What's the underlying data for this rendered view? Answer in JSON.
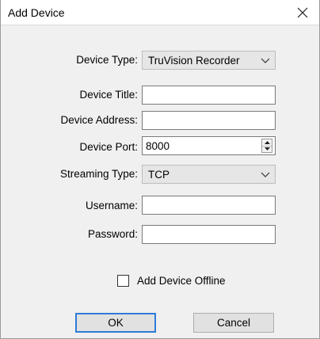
{
  "dialog": {
    "title": "Add Device",
    "close_icon": "close-icon"
  },
  "fields": {
    "device_type": {
      "label": "Device Type:",
      "value": "TruVision Recorder"
    },
    "device_title": {
      "label": "Device Title:",
      "value": ""
    },
    "device_address": {
      "label": "Device Address:",
      "value": ""
    },
    "device_port": {
      "label": "Device Port:",
      "value": "8000"
    },
    "streaming_type": {
      "label": "Streaming Type:",
      "value": "TCP"
    },
    "username": {
      "label": "Username:",
      "value": ""
    },
    "password": {
      "label": "Password:",
      "value": ""
    }
  },
  "offline": {
    "label": "Add Device Offline",
    "checked": false
  },
  "buttons": {
    "ok": "OK",
    "cancel": "Cancel"
  }
}
